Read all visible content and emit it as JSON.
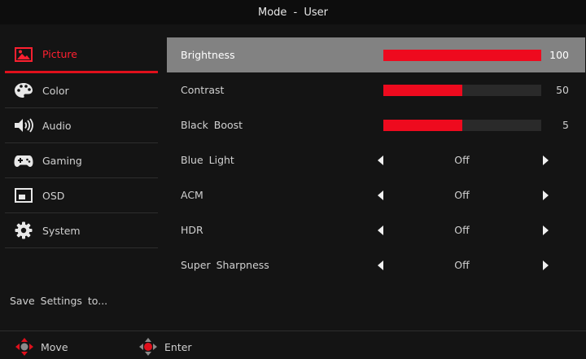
{
  "header": {
    "title": "Mode - User"
  },
  "sidebar": {
    "items": [
      {
        "label": "Picture",
        "icon": "picture-icon",
        "active": true
      },
      {
        "label": "Color",
        "icon": "palette-icon",
        "active": false
      },
      {
        "label": "Audio",
        "icon": "speaker-icon",
        "active": false
      },
      {
        "label": "Gaming",
        "icon": "gamepad-icon",
        "active": false
      },
      {
        "label": "OSD",
        "icon": "osd-icon",
        "active": false
      },
      {
        "label": "System",
        "icon": "gear-icon",
        "active": false
      }
    ],
    "save_label": "Save Settings to..."
  },
  "settings": {
    "brightness": {
      "label": "Brightness",
      "value": "100",
      "fraction": 1.0
    },
    "contrast": {
      "label": "Contrast",
      "value": "50",
      "fraction": 0.5
    },
    "black_boost": {
      "label": "Black Boost",
      "value": "5",
      "fraction": 0.5
    },
    "blue_light": {
      "label": "Blue Light",
      "value": "Off"
    },
    "acm": {
      "label": "ACM",
      "value": "Off"
    },
    "hdr": {
      "label": "HDR",
      "value": "Off"
    },
    "super_sharpness": {
      "label": "Super Sharpness",
      "value": "Off"
    }
  },
  "footer": {
    "move_label": "Move",
    "enter_label": "Enter"
  },
  "colors": {
    "accent": "#ee0a1e",
    "selected_row": "#828282",
    "background": "#141414"
  }
}
